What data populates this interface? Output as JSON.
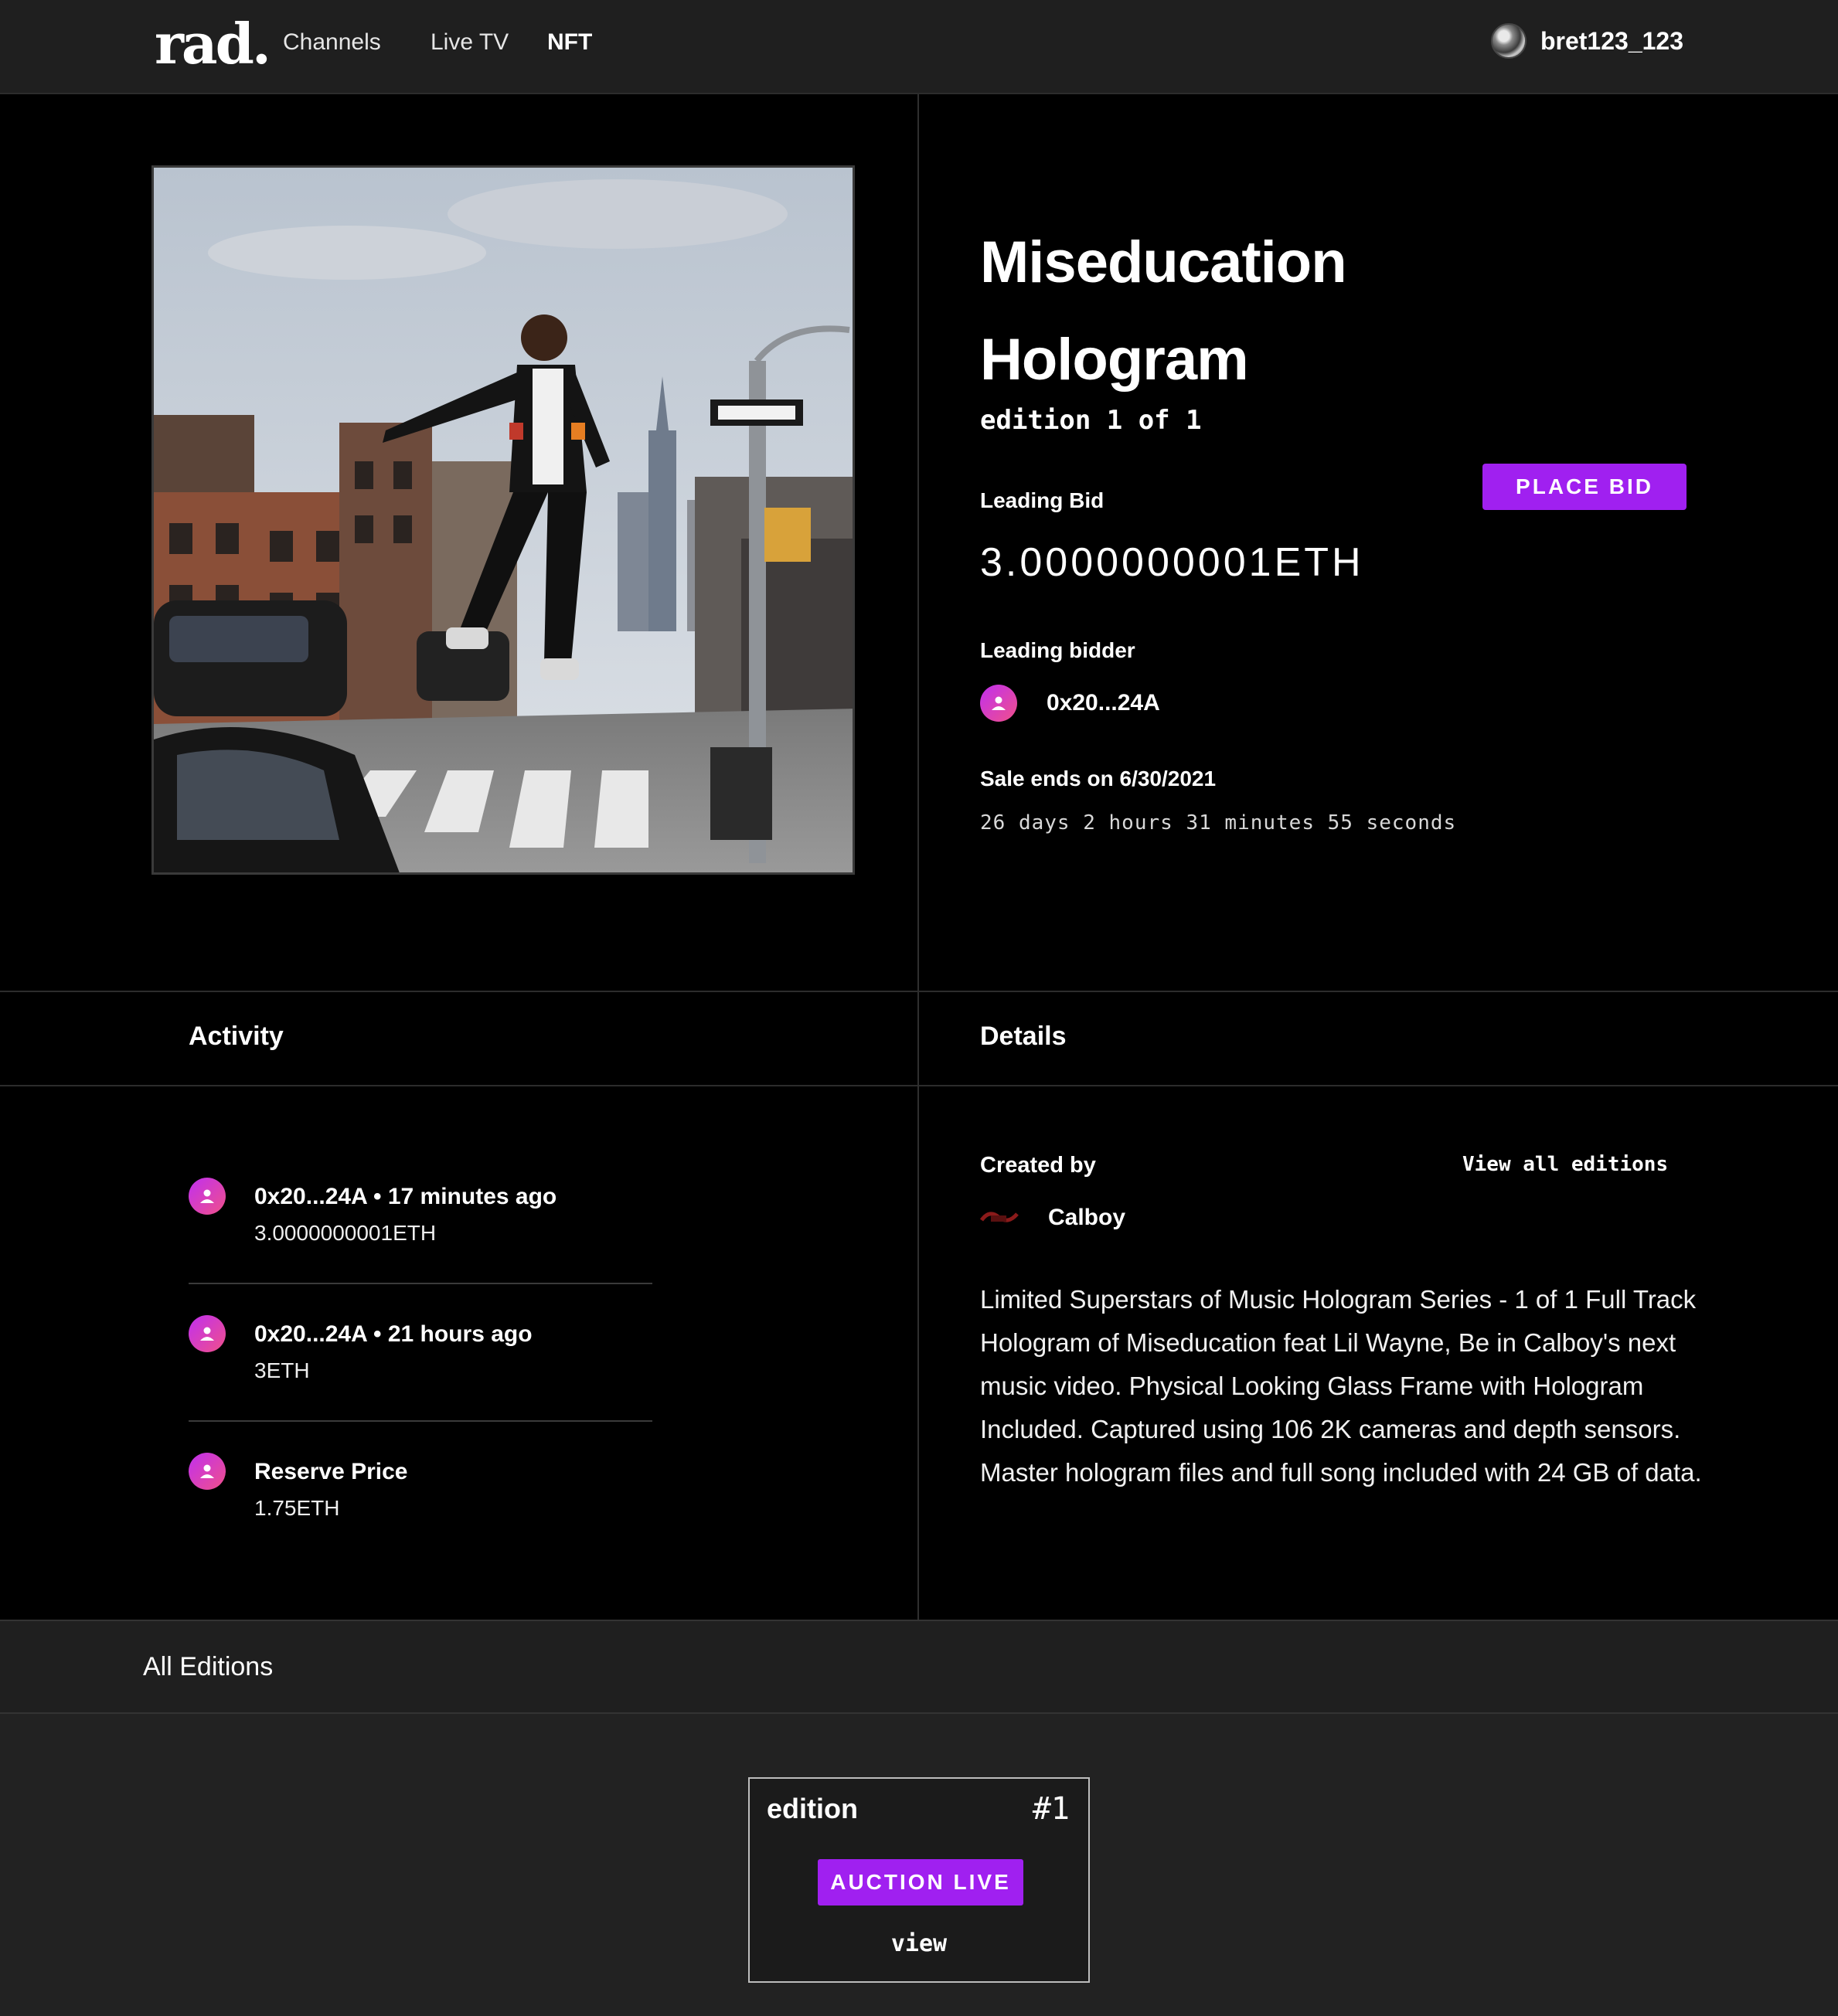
{
  "nav": {
    "logo": "rad.",
    "links": [
      "Channels",
      "Live TV",
      "NFT"
    ],
    "username": "bret123_123"
  },
  "nft": {
    "title_line1": "Miseducation",
    "title_line2": "Hologram",
    "edition": "edition 1 of 1",
    "leading_bid_label": "Leading Bid",
    "leading_bid_value": "3.0000000001ETH",
    "place_bid_label": "PLACE BID",
    "leading_bidder_label": "Leading bidder",
    "leading_bidder": "0x20...24A",
    "sale_ends": "Sale ends on 6/30/2021",
    "countdown": "26 days 2 hours 31 minutes 55 seconds"
  },
  "sections": {
    "activity": "Activity",
    "details": "Details"
  },
  "activity": [
    {
      "title": "0x20...24A  •  17 minutes ago",
      "value": "3.0000000001ETH"
    },
    {
      "title": "0x20...24A  •  21 hours ago",
      "value": "3ETH"
    },
    {
      "title": "Reserve Price",
      "value": "1.75ETH"
    }
  ],
  "details": {
    "created_by_label": "Created by",
    "view_all": "View all editions",
    "creator": "Calboy",
    "description": "Limited Superstars of Music Hologram Series - 1 of 1 Full Track Hologram of Miseducation feat Lil Wayne, Be in Calboy's next music video. Physical Looking Glass Frame with Hologram Included. Captured using 106 2K cameras and depth sensors. Master hologram files and full song included with 24 GB of data."
  },
  "editions": {
    "title": "All Editions",
    "card": {
      "label": "edition",
      "number": "#1",
      "status": "AUCTION LIVE",
      "view": "view"
    }
  },
  "colors": {
    "accent": "#a020f0",
    "topbar": "#1f1f1f",
    "background": "#000000"
  }
}
